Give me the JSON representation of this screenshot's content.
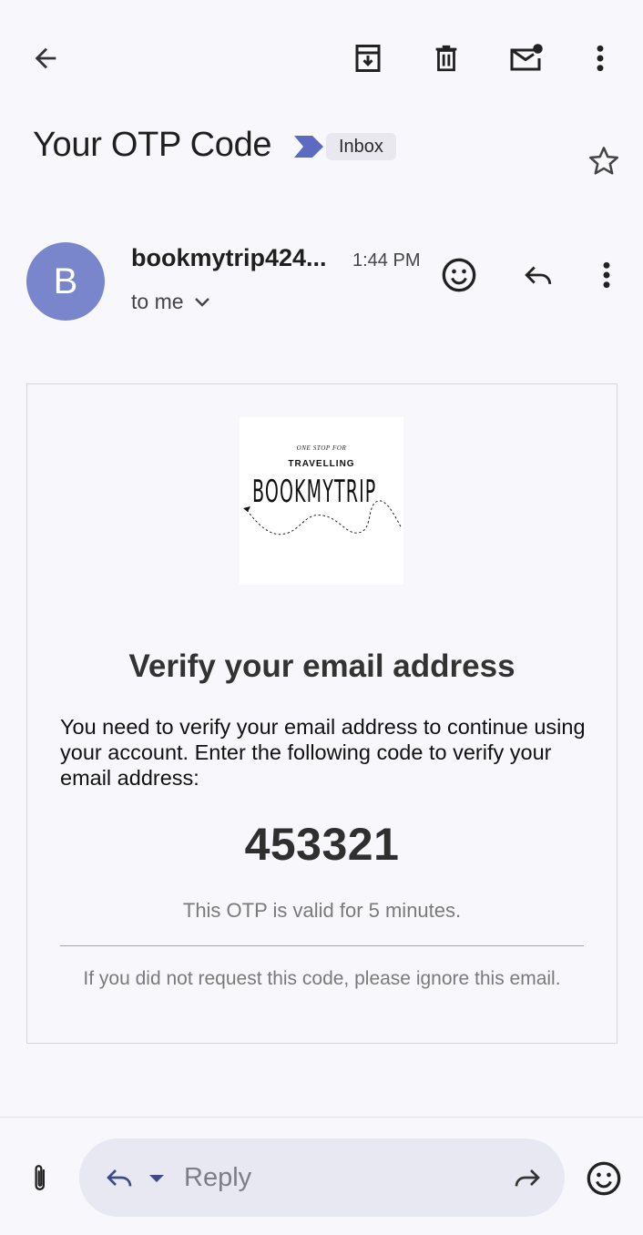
{
  "toolbar": {
    "back_icon": "arrow-left-icon",
    "archive_icon": "archive-icon",
    "delete_icon": "trash-icon",
    "mark_unread_icon": "mark-unread-icon",
    "more_icon": "more-vert-icon"
  },
  "subject": {
    "title": "Your OTP Code",
    "label": "Inbox",
    "importance_color": "#5c6bc0"
  },
  "sender": {
    "initial": "B",
    "name": "bookmytrip424...",
    "time": "1:44 PM",
    "recipient": "to me",
    "avatar_color": "#7986cb"
  },
  "email": {
    "logo": {
      "tagline": "ONE STOP FOR",
      "subtitle": "TRAVELLING",
      "brand": "BOOKMYTRIP"
    },
    "heading": "Verify your email address",
    "instructions": "You need to verify your email address to continue using your account. Enter the following code to verify your email address:",
    "otp": "453321",
    "validity": "This OTP is valid for 5 minutes.",
    "disclaimer": "If you did not request this code, please ignore this email."
  },
  "bottom": {
    "reply_placeholder": "Reply"
  }
}
